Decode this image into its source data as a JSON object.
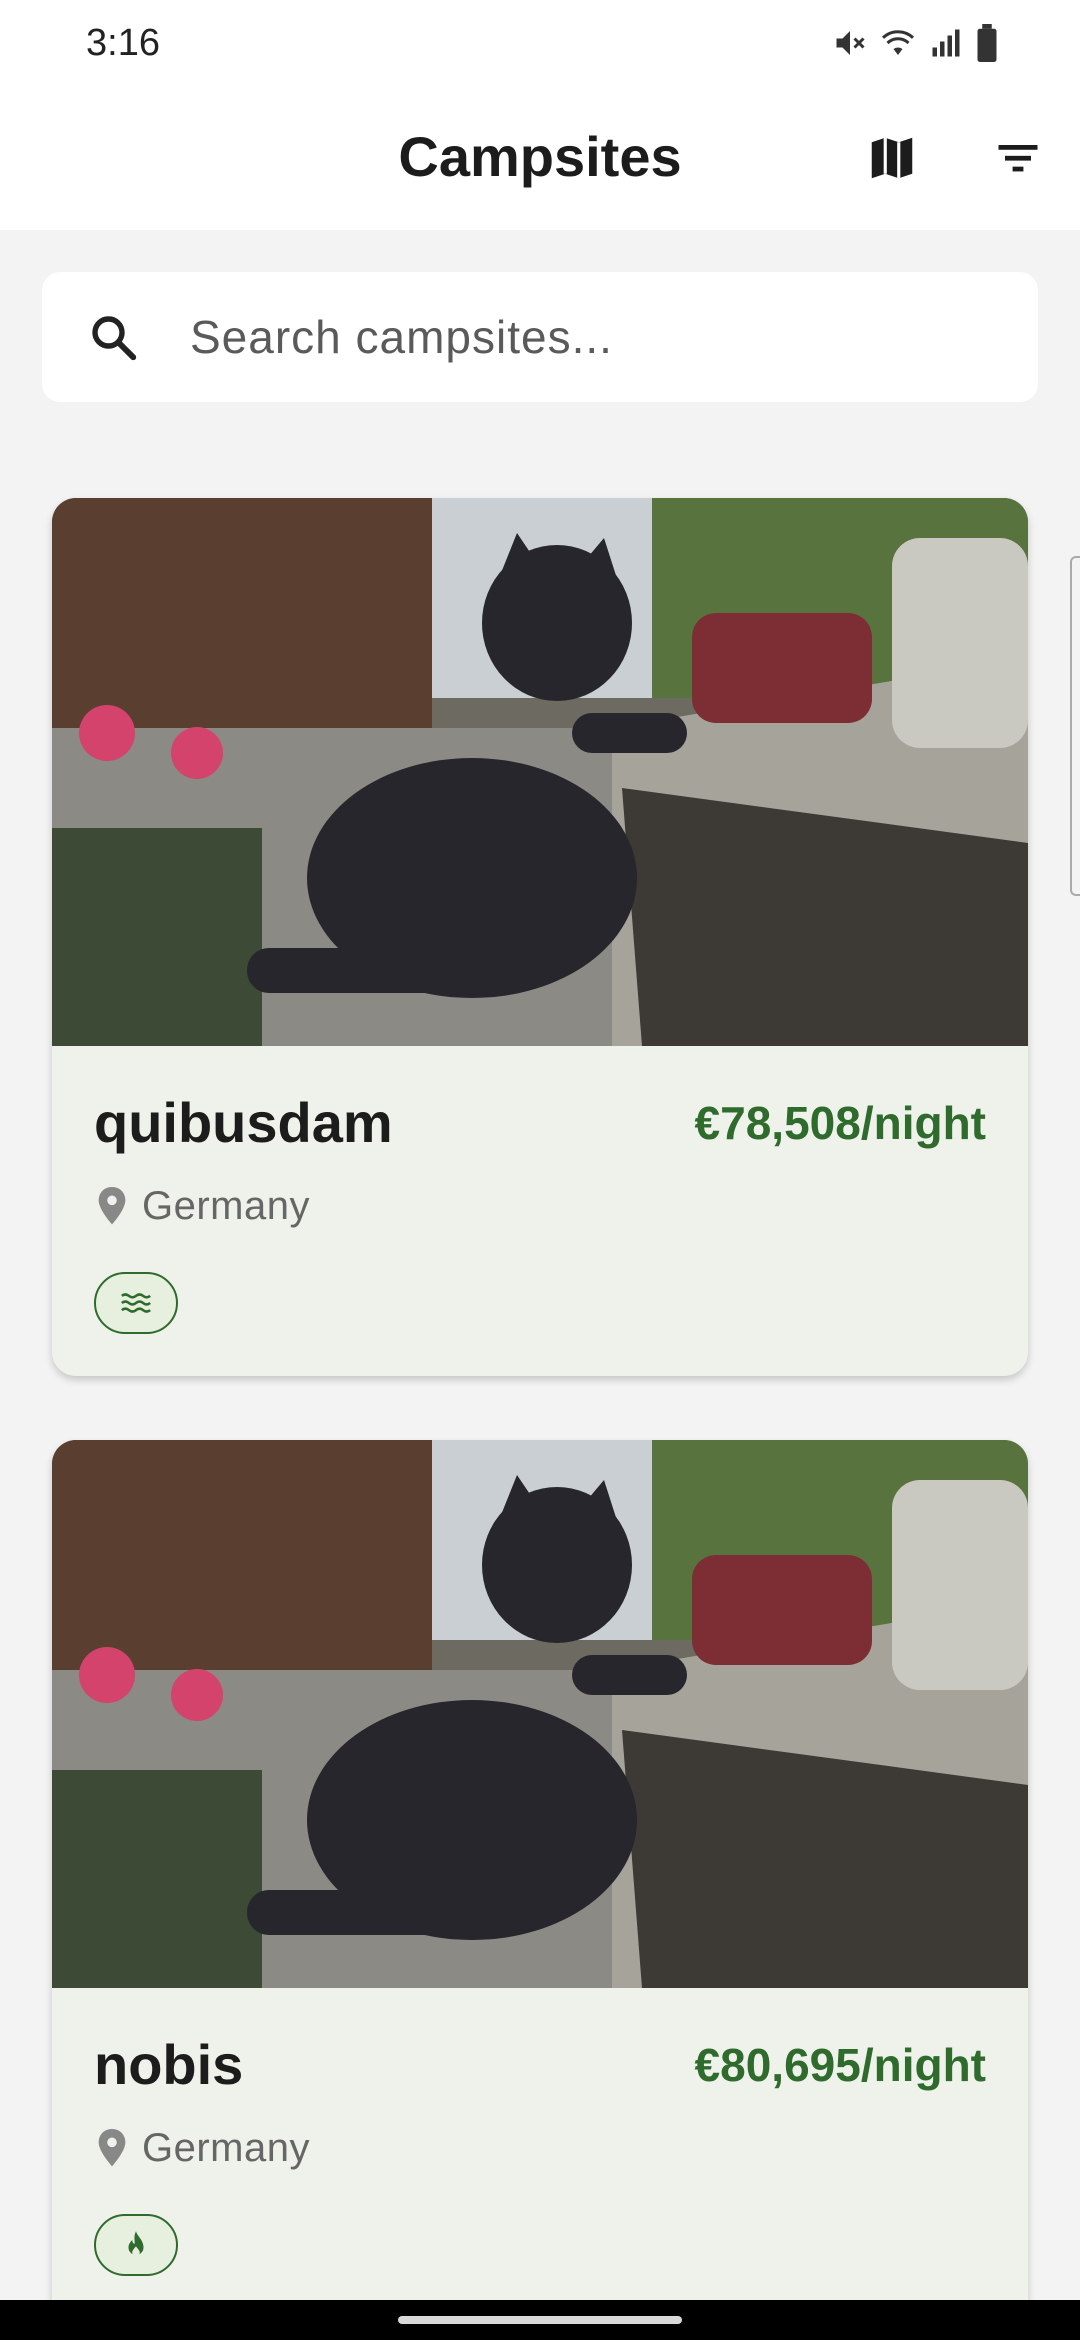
{
  "status_bar": {
    "time": "3:16",
    "icons": [
      "mute-icon",
      "wifi-icon",
      "signal-icon",
      "battery-icon"
    ]
  },
  "app_bar": {
    "title": "Campsites",
    "actions": [
      "map-icon",
      "filter-icon"
    ]
  },
  "search": {
    "placeholder": "Search campsites...",
    "value": ""
  },
  "campsites": [
    {
      "name": "quibusdam",
      "price": "€78,508/night",
      "location": "Germany",
      "amenity_icon": "water-waves-icon"
    },
    {
      "name": "nobis",
      "price": "€80,695/night",
      "location": "Germany",
      "amenity_icon": "campfire-icon"
    }
  ],
  "colors": {
    "accent": "#2f6b2d",
    "card_background": "#eff2ea",
    "page_background": "#f3f3f3"
  }
}
